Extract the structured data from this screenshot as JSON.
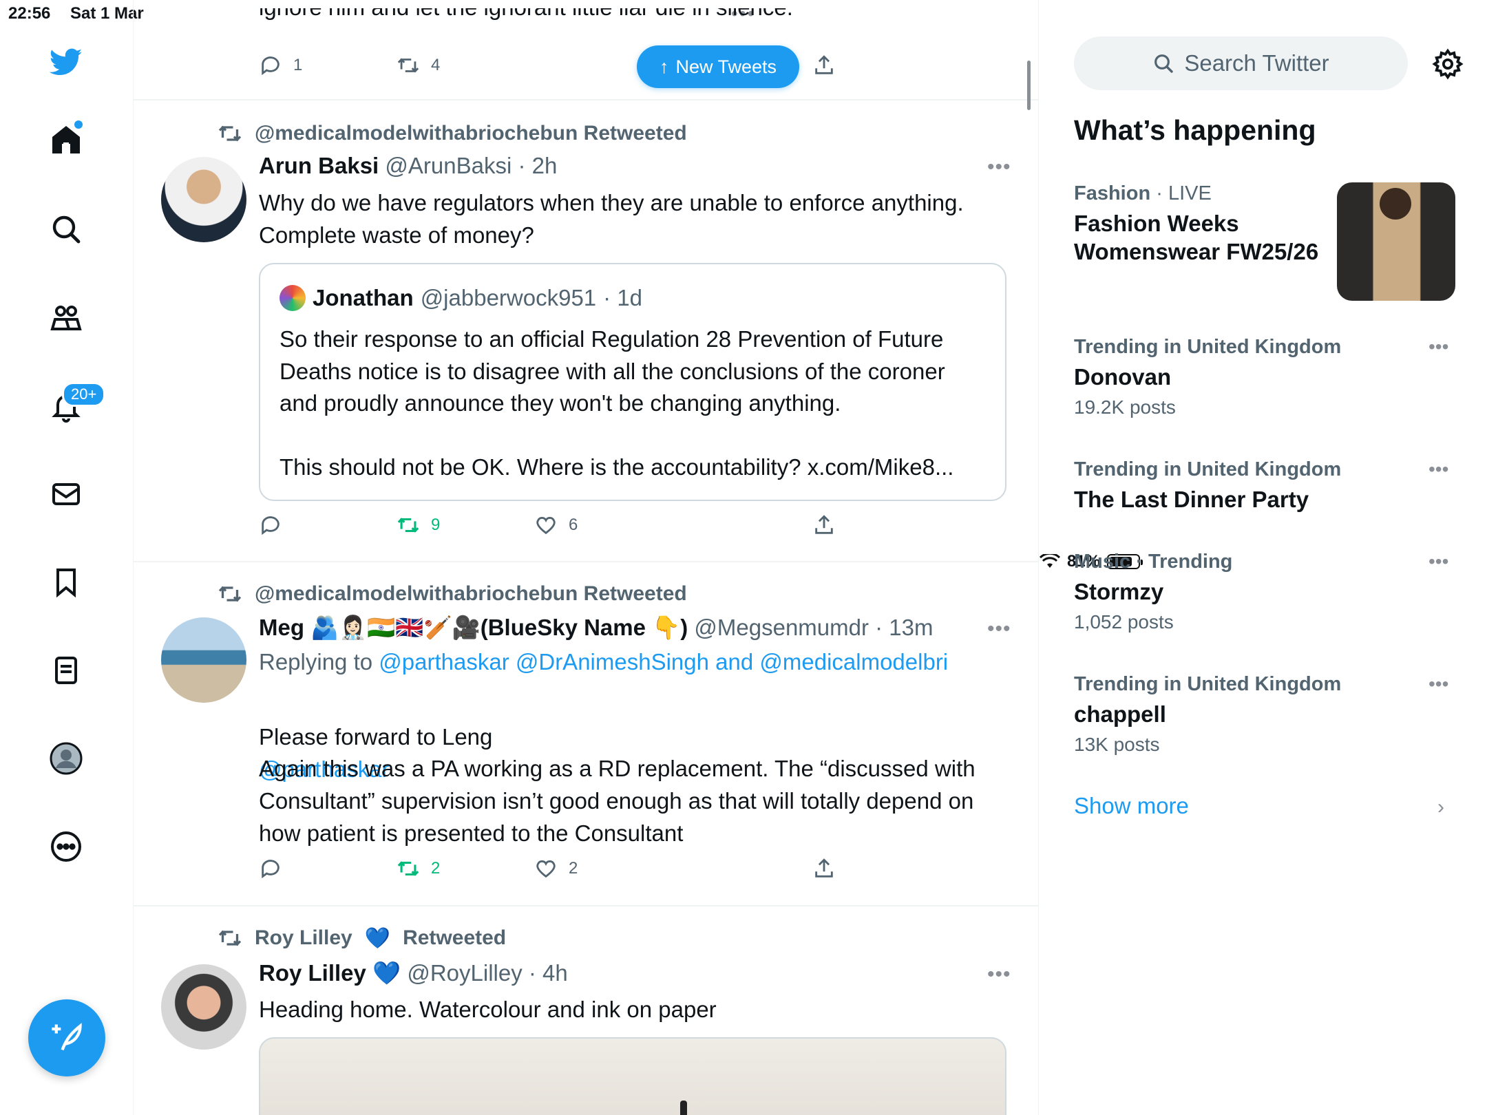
{
  "status_bar": {
    "time": "22:56",
    "date": "Sat 1 Mar",
    "battery": "81%",
    "battery_level": 0.81
  },
  "nav": {
    "notifications_badge": "20+"
  },
  "feed": {
    "new_tweets_label": "New Tweets",
    "top_tweet": {
      "text_cut": "ignore him and let the ignorant little liar die in silence.",
      "replies": "1",
      "retweets": "4"
    },
    "tweets": [
      {
        "retweeted_by": "@medicalmodelwithabriochebun Retweeted",
        "name": "Arun Baksi",
        "handle": "@ArunBaksi",
        "time": "· 2h",
        "text": "Why do we have regulators when they are unable to enforce anything.\nComplete waste of money?",
        "quote": {
          "name": "Jonathan",
          "handle": "@jabberwock951",
          "time": "· 1d",
          "text": "So their response to an official Regulation 28 Prevention of Future Deaths notice is to disagree with all the conclusions of the coroner and proudly announce they won't be changing anything.\n\nThis should not be OK. Where is the accountability? x.com/Mike8..."
        },
        "retweets": "9",
        "likes": "6"
      },
      {
        "retweeted_by": "@medicalmodelwithabriochebun Retweeted",
        "name": "Meg 🫂👩🏻‍⚕️🇮🇳🇬🇧🏏🎥(BlueSky Name 👇)",
        "handle": "@Megsenmumdr",
        "time": "· 13m",
        "replying_prefix": "Replying to",
        "replying_to": "@parthaskar @DrAnimeshSingh and @medicalmodelbri",
        "text_prefix": "Please forward to Leng",
        "text_mention": "@parthaskar",
        "text_body": "Again this was a PA working as a RD replacement. The “discussed with Consultant” supervision isn’t good enough as that will totally depend on how patient is presented to the Consultant",
        "retweets": "2",
        "likes": "2"
      },
      {
        "retweeted_by_name": "Roy Lilley",
        "retweeted_suffix": "Retweeted",
        "name": "Roy Lilley",
        "heart": "💙",
        "handle": "@RoyLilley",
        "time": "· 4h",
        "text": "Heading home. Watercolour and ink on paper"
      }
    ]
  },
  "sidebar": {
    "search_placeholder": "Search Twitter",
    "whats_happening": "What’s happening",
    "trends": [
      {
        "category": "Fashion",
        "sub": "· LIVE",
        "topic": "Fashion Weeks Womenswear FW25/26",
        "posts": ""
      },
      {
        "category": "Trending in United Kingdom",
        "sub": "",
        "topic": "Donovan",
        "posts": "19.2K posts"
      },
      {
        "category": "Trending in United Kingdom",
        "sub": "",
        "topic": "The Last Dinner Party",
        "posts": ""
      },
      {
        "category": "Music · Trending",
        "sub": "",
        "topic": "Stormzy",
        "posts": "1,052 posts"
      },
      {
        "category": "Trending in United Kingdom",
        "sub": "",
        "topic": "chappell",
        "posts": "13K posts"
      }
    ],
    "show_more": "Show more"
  },
  "colors": {
    "accent": "#1d9bf0",
    "retweet_green": "#00ba7c",
    "muted": "#536471"
  }
}
